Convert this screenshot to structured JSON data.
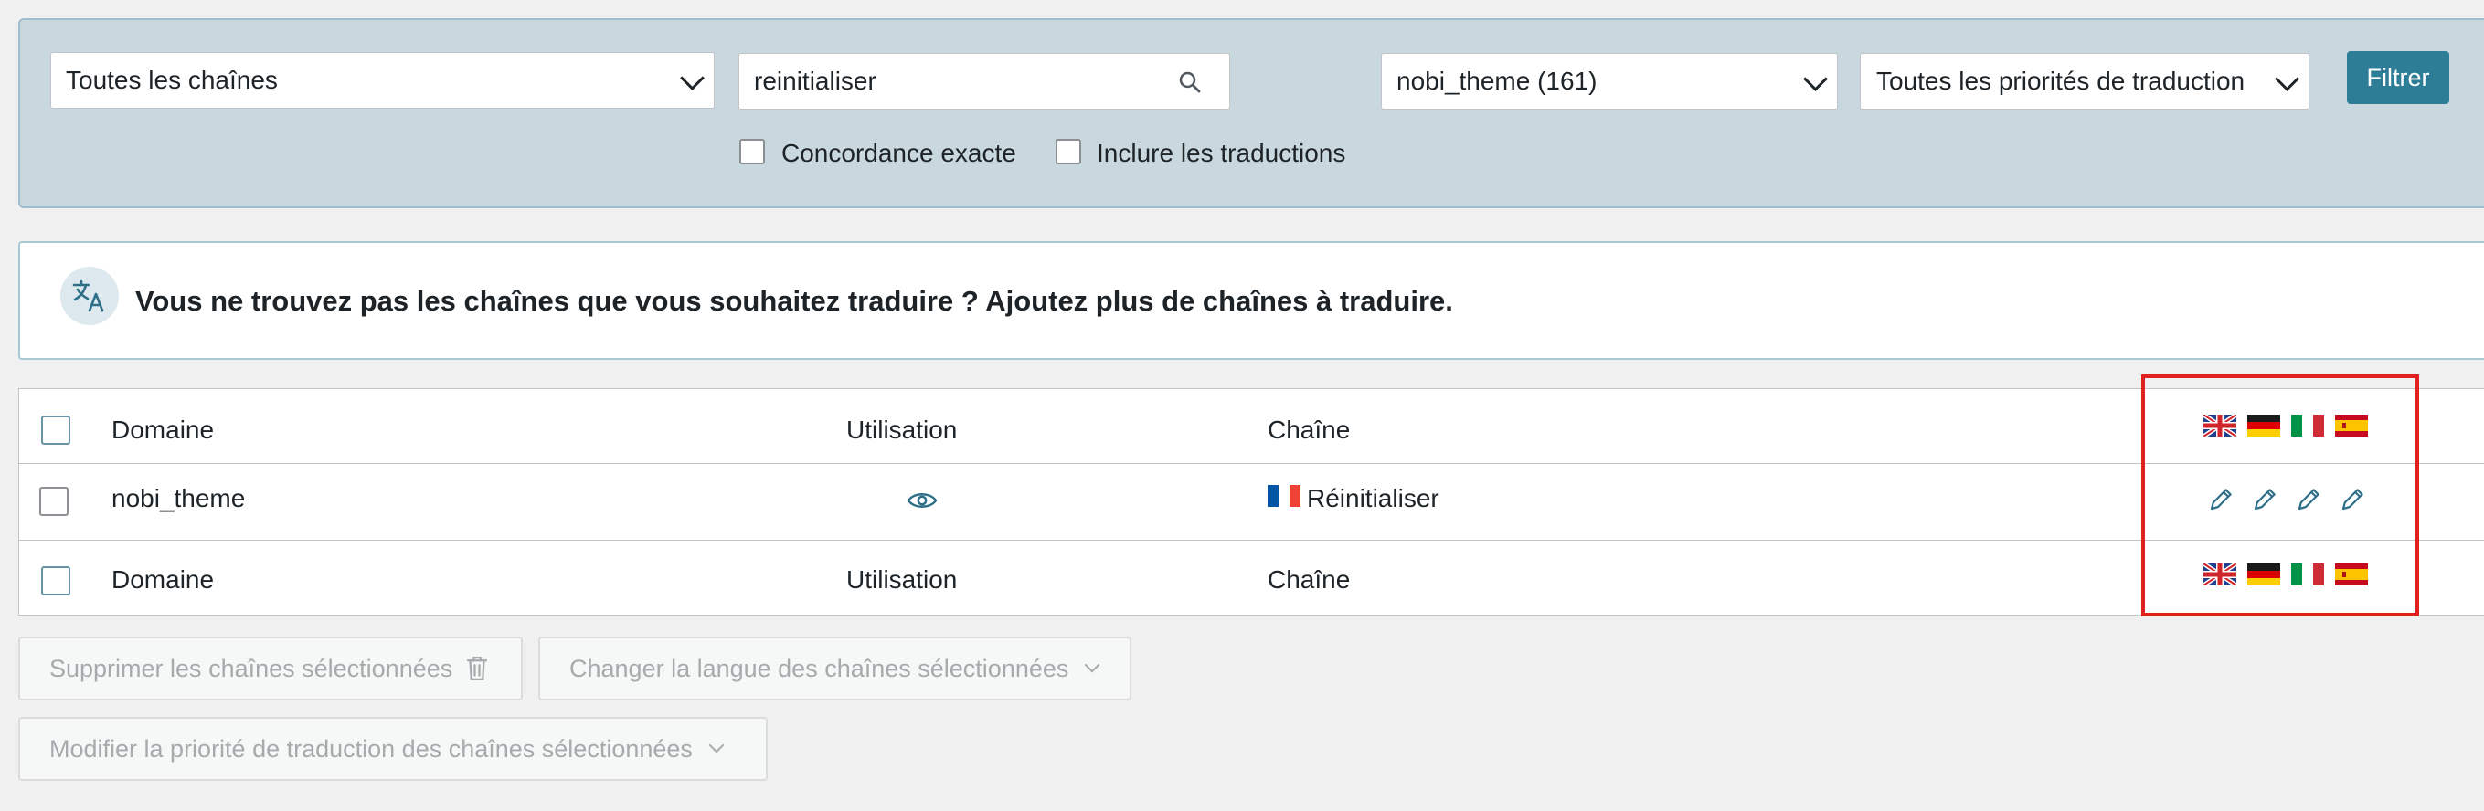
{
  "filters": {
    "all_strings": "Toutes les chaînes",
    "search_value": "reinitialiser",
    "domain": "nobi_theme (161)",
    "priority": "Toutes les priorités de traduction",
    "filter_button": "Filtrer",
    "exact_match": "Concordance exacte",
    "include_translations": "Inclure les traductions"
  },
  "notice": {
    "message": "Vous ne trouvez pas les chaînes que vous souhaitez traduire ? Ajoutez plus de chaînes à traduire."
  },
  "table": {
    "columns": {
      "domain": "Domaine",
      "usage": "Utilisation",
      "string": "Chaîne"
    },
    "row": {
      "domain": "nobi_theme",
      "string": "Réinitialiser"
    },
    "language_flags": [
      "flag-uk-icon",
      "flag-de-icon",
      "flag-it-icon",
      "flag-es-icon"
    ]
  },
  "bulk_actions": {
    "delete": "Supprimer les chaînes sélectionnées",
    "change_language": "Changer la langue des chaînes sélectionnées",
    "change_priority": "Modifier la priorité de traduction des chaînes sélectionnées"
  },
  "colors": {
    "accent": "#2e7d97",
    "filter_panel_bg": "#c9d8de",
    "highlight": "#e32020"
  }
}
